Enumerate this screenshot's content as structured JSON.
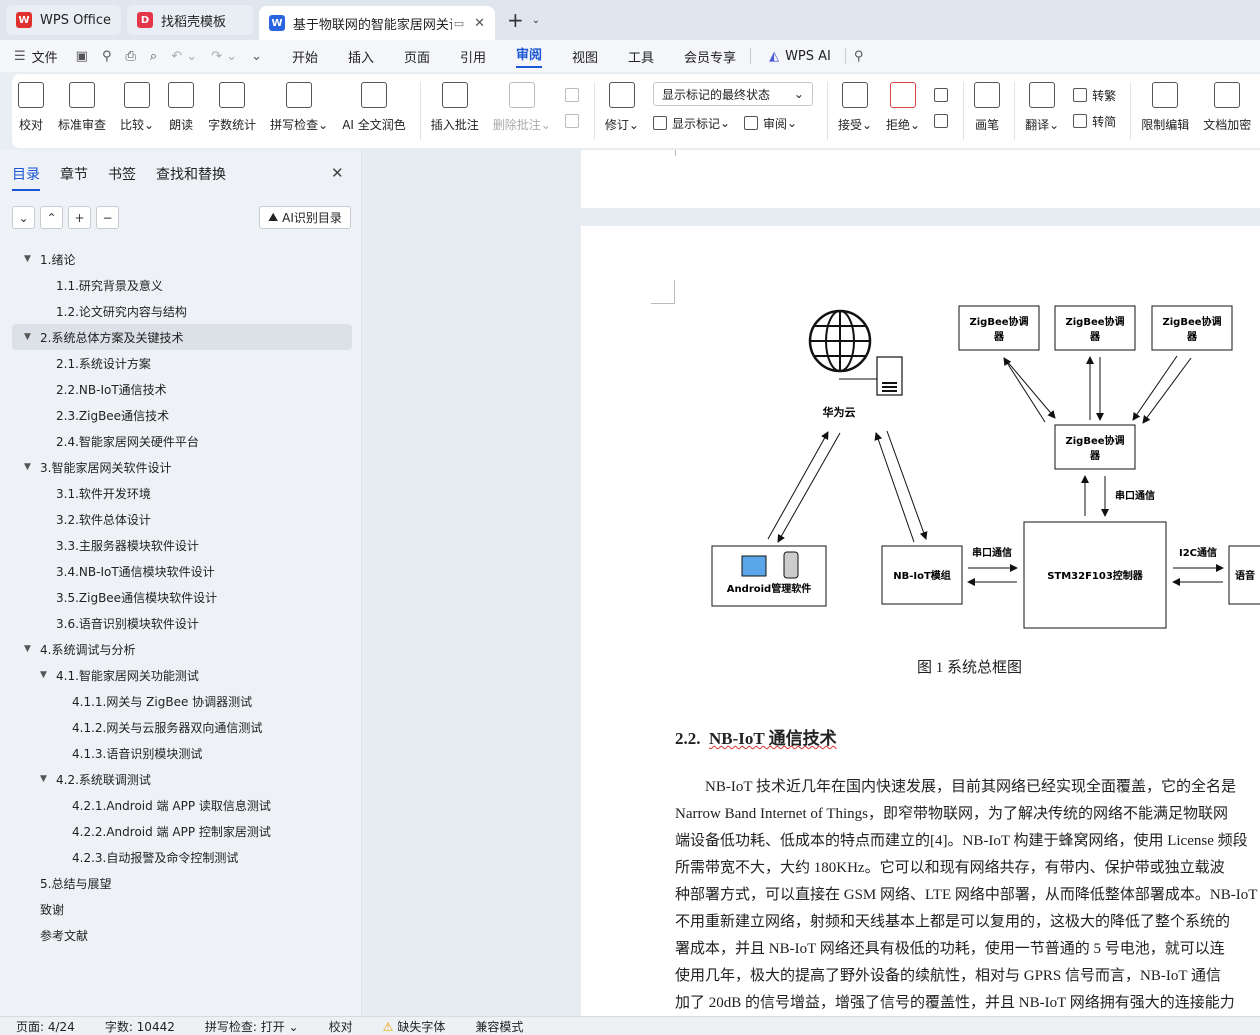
{
  "tabs": [
    {
      "label": "WPS Office",
      "color": "#e0312d",
      "letter": "W"
    },
    {
      "label": "找稻壳模板",
      "color": "#e6374a",
      "letter": "D"
    },
    {
      "label": "基于物联网的智能家居网关设",
      "color": "#2b64e0",
      "letter": "W"
    }
  ],
  "menubar": {
    "file": "文件",
    "items": [
      "开始",
      "插入",
      "页面",
      "引用",
      "审阅",
      "视图",
      "工具",
      "会员专享"
    ],
    "active": "审阅",
    "wps_ai": "WPS AI"
  },
  "ribbon": {
    "proofread": "校对",
    "std_review": "标准审查",
    "compare": "比较",
    "read_aloud": "朗读",
    "word_count": "字数统计",
    "spell_check": "拼写检查",
    "ai_polish": "AI 全文润色",
    "insert_comment": "插入批注",
    "delete_comment": "删除批注",
    "revise": "修订",
    "markup_select": "显示标记的最终状态",
    "show_markup": "显示标记",
    "review": "审阅",
    "accept": "接受",
    "reject": "拒绝",
    "pen": "画笔",
    "translate": "翻译",
    "to_traditional": "转繁",
    "to_simplified": "转简",
    "restrict_edit": "限制编辑",
    "doc_encrypt": "文档加密"
  },
  "nav": {
    "tabs": [
      "目录",
      "章节",
      "书签",
      "查找和替换"
    ],
    "ai_button": "AI识别目录",
    "toc": [
      {
        "text": "1.绪论",
        "level": 1,
        "arrow": true
      },
      {
        "text": "1.1.研究背景及意义",
        "level": 2
      },
      {
        "text": "1.2.论文研究内容与结构",
        "level": 2
      },
      {
        "text": "2.系统总体方案及关键技术",
        "level": 1,
        "arrow": true,
        "selected": true
      },
      {
        "text": "2.1.系统设计方案",
        "level": 2
      },
      {
        "text": "2.2.NB-IoT通信技术",
        "level": 2
      },
      {
        "text": "2.3.ZigBee通信技术",
        "level": 2
      },
      {
        "text": "2.4.智能家居网关硬件平台",
        "level": 2
      },
      {
        "text": "3.智能家居网关软件设计",
        "level": 1,
        "arrow": true
      },
      {
        "text": "3.1.软件开发环境",
        "level": 2
      },
      {
        "text": "3.2.软件总体设计",
        "level": 2
      },
      {
        "text": "3.3.主服务器模块软件设计",
        "level": 2
      },
      {
        "text": "3.4.NB-IoT通信模块软件设计",
        "level": 2
      },
      {
        "text": "3.5.ZigBee通信模块软件设计",
        "level": 2
      },
      {
        "text": "3.6.语音识别模块软件设计",
        "level": 2
      },
      {
        "text": "4.系统调试与分析",
        "level": 1,
        "arrow": true
      },
      {
        "text": "4.1.智能家居网关功能测试",
        "level": 2,
        "arrow": true
      },
      {
        "text": "4.1.1.网关与 ZigBee 协调器测试",
        "level": 3
      },
      {
        "text": "4.1.2.网关与云服务器双向通信测试",
        "level": 3
      },
      {
        "text": "4.1.3.语音识别模块测试",
        "level": 3
      },
      {
        "text": "4.2.系统联调测试",
        "level": 2,
        "arrow": true
      },
      {
        "text": "4.2.1.Android 端 APP 读取信息测试",
        "level": 3
      },
      {
        "text": "4.2.2.Android 端 APP 控制家居测试",
        "level": 3
      },
      {
        "text": "4.2.3.自动报警及命令控制测试",
        "level": 3
      },
      {
        "text": "5.总结与展望",
        "level": 1
      },
      {
        "text": "致谢",
        "level": 1
      },
      {
        "text": "参考文献",
        "level": 1
      }
    ]
  },
  "diagram": {
    "zigbee_node": "ZigBee协调器",
    "zigbee_node_line1": "ZigBee协调",
    "zigbee_node_line2": "器",
    "cloud": "华为云",
    "serial1": "串口通信",
    "serial2": "串口通信",
    "i2c": "I2C通信",
    "android": "Android管理软件",
    "nbiot": "NB-IoT模组",
    "mcu": "STM32F103控制器",
    "voice": "语音"
  },
  "document": {
    "caption": "图 1 系统总框图",
    "heading_num": "2.2.",
    "heading_text": "NB-IoT 通信技术",
    "paragraph_lines": [
      "NB-IoT 技术近几年在国内快速发展，目前其网络已经实现全面覆盖，它的全名是",
      "Narrow Band Internet of Things，即窄带物联网，为了解决传统的网络不能满足物联网",
      "端设备低功耗、低成本的特点而建立的[4]。NB-IoT 构建于蜂窝网络，使用 License 频段",
      "所需带宽不大，大约 180KHz。它可以和现有网络共存，有带内、保护带或独立载波",
      "种部署方式，可以直接在 GSM 网络、LTE 网络中部署，从而降低整体部署成本。NB-IoT",
      "不用重新建立网络，射频和天线基本上都是可以复用的，这极大的降低了整个系统的",
      "署成本，并且 NB-IoT 网络还具有极低的功耗，使用一节普通的 5 号电池，就可以连",
      "使用几年，极大的提高了野外设备的续航性，相对与 GPRS 信号而言，NB-IoT 通信",
      "加了 20dB 的信号增益，增强了信号的覆盖性，并且 NB-IoT 网络拥有强大的连接能力"
    ]
  },
  "status": {
    "page": "页面: 4/24",
    "words": "字数: 10442",
    "spell": "拼写检查: 打开",
    "proof": "校对",
    "missing_font": "缺失字体",
    "compat": "兼容模式"
  }
}
